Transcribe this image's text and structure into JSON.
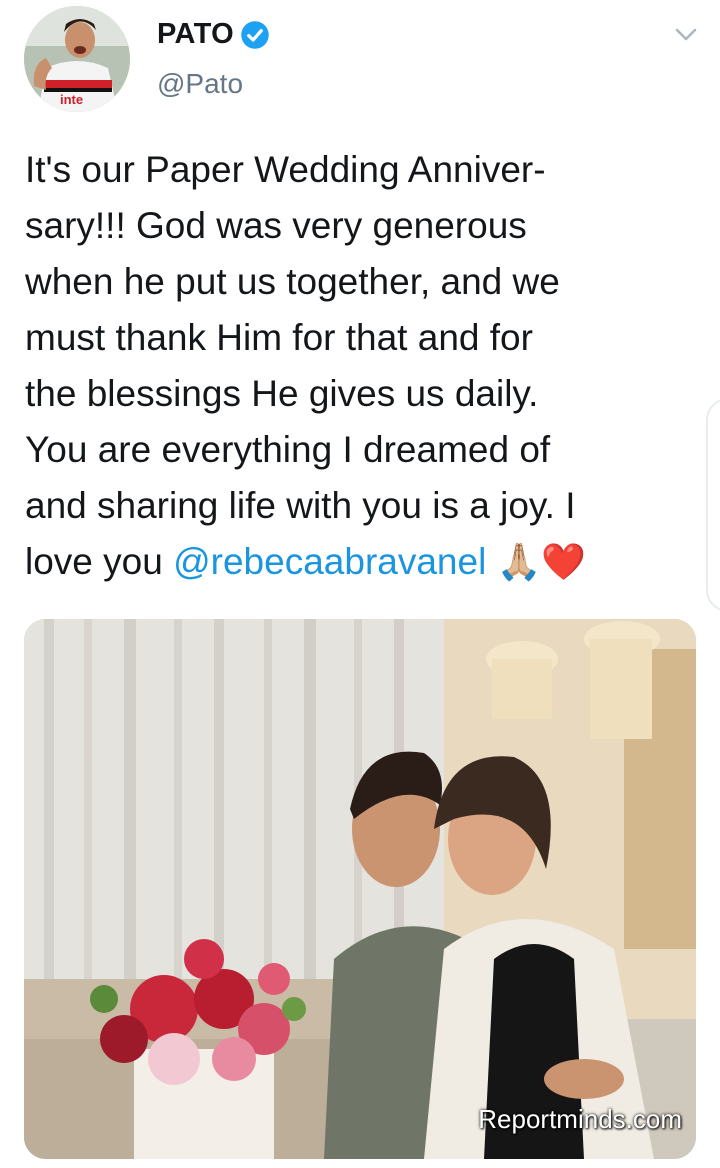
{
  "tweet": {
    "author": {
      "display_name": "PATO",
      "handle": "@Pato",
      "verified": true,
      "avatar_icon": "player-avatar",
      "jersey_text": "inte"
    },
    "text_lines": [
      "It's our Paper Wedding Anniver-",
      "sary!!! God was very generous",
      "when he put us together, and we",
      "must thank Him for that and for",
      "the blessings He gives us daily.",
      "You are everything I dreamed of",
      "and sharing life with you is a joy. I"
    ],
    "last_line_prefix": "love you ",
    "mention": "@rebecaabravanel",
    "emojis": "🙏🏼❤️",
    "menu_icon": "chevron-down-icon",
    "photo": {
      "description_icon": "couple-photo",
      "watermark": "Reportminds.com"
    }
  },
  "colors": {
    "text": "#14171a",
    "secondary": "#657786",
    "link": "#1b95e0",
    "verified": "#1da1f2"
  }
}
